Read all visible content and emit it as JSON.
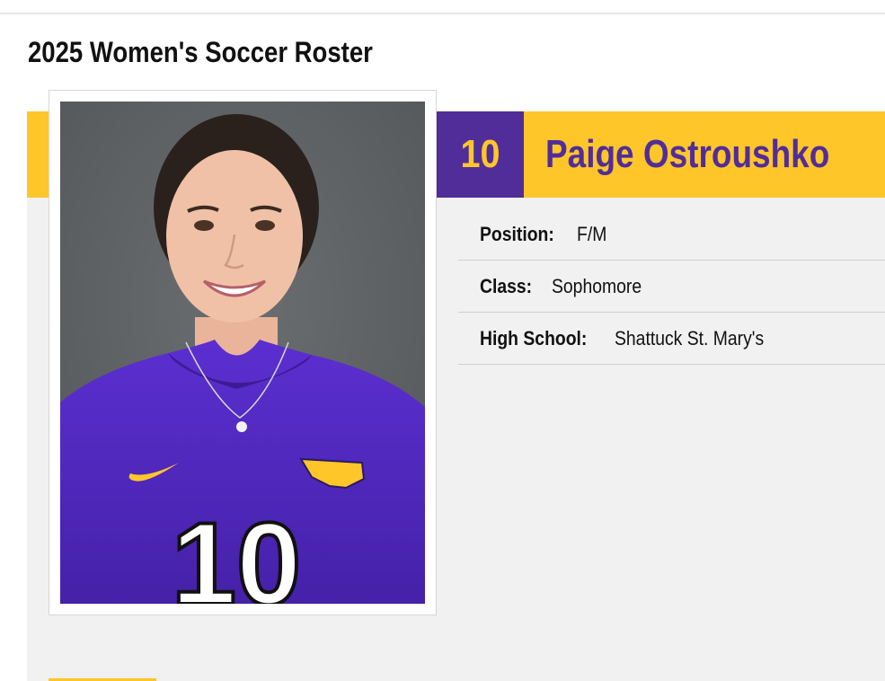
{
  "page": {
    "title": "2025 Women's Soccer Roster"
  },
  "player": {
    "number": "10",
    "name": "Paige Ostroushko",
    "jersey_number_on_photo": "10",
    "details": [
      {
        "label": "Position:",
        "value": "F/M"
      },
      {
        "label": "Class:",
        "value": "Sophomore"
      },
      {
        "label": "High School:",
        "value": "Shattuck St. Mary's"
      }
    ]
  },
  "colors": {
    "purple": "#512d9a",
    "gold": "#ffc629",
    "panel": "#f1f1f1"
  },
  "icons": {
    "photo": "player-headshot-image"
  }
}
